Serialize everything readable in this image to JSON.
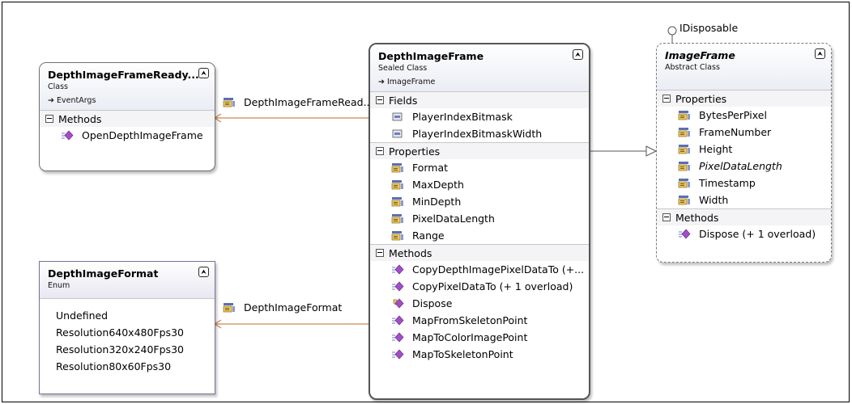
{
  "interface_label": "IDisposable",
  "classes": {
    "ready_args": {
      "title": "DepthImageFrameReady...",
      "kind": "Class",
      "base": "EventArgs",
      "methods_header": "Methods",
      "methods": [
        "OpenDepthImageFrame"
      ]
    },
    "depth_frame": {
      "title": "DepthImageFrame",
      "kind": "Sealed Class",
      "base": "ImageFrame",
      "fields_header": "Fields",
      "fields": [
        "PlayerIndexBitmask",
        "PlayerIndexBitmaskWidth"
      ],
      "properties_header": "Properties",
      "properties": [
        "Format",
        "MaxDepth",
        "MinDepth",
        "PixelDataLength",
        "Range"
      ],
      "methods_header": "Methods",
      "methods": [
        "CopyDepthImagePixelDataTo  (+...",
        "CopyPixelDataTo (+ 1 overload)",
        "Dispose",
        "MapFromSkeletonPoint",
        "MapToColorImagePoint",
        "MapToSkeletonPoint"
      ]
    },
    "image_frame": {
      "title": "ImageFrame",
      "kind": "Abstract Class",
      "properties_header": "Properties",
      "properties": [
        "BytesPerPixel",
        "FrameNumber",
        "Height",
        "PixelDataLength",
        "Timestamp",
        "Width"
      ],
      "methods_header": "Methods",
      "methods": [
        "Dispose (+ 1 overload)"
      ]
    },
    "depth_format": {
      "title": "DepthImageFormat",
      "kind": "Enum",
      "values": [
        "Undefined",
        "Resolution640x480Fps30",
        "Resolution320x240Fps30",
        "Resolution80x60Fps30"
      ]
    }
  },
  "associations": {
    "ready_to_frame": "DepthImageFrameRead...",
    "frame_to_format": "DepthImageFormat"
  },
  "icons": {
    "collapse": "double-chevron-up-icon",
    "section_toggle": "minus-box-icon",
    "inheritance": "arrow-inherit-icon",
    "field": "field-icon",
    "property": "property-icon",
    "method": "method-icon"
  },
  "colors": {
    "association_line": "#c9894f",
    "inheritance_line": "#555555",
    "method_icon": "#a14fc7"
  }
}
